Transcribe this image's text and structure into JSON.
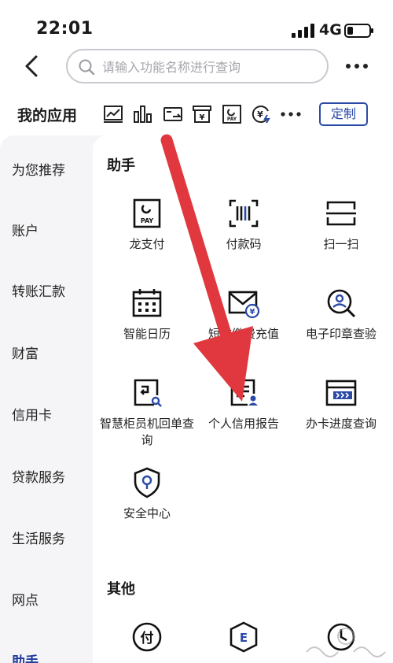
{
  "status_bar": {
    "time": "22:01",
    "network": "4G"
  },
  "search": {
    "placeholder": "请输入功能名称进行查询"
  },
  "my_apps": {
    "title": "我的应用",
    "custom_label": "定制"
  },
  "sidebar": {
    "items": [
      {
        "label": "为您推荐"
      },
      {
        "label": "账户"
      },
      {
        "label": "转账汇款"
      },
      {
        "label": "财富"
      },
      {
        "label": "信用卡"
      },
      {
        "label": "贷款服务"
      },
      {
        "label": "生活服务"
      },
      {
        "label": "网点"
      },
      {
        "label": "助手"
      }
    ],
    "active_index": 8
  },
  "sections": {
    "assistant": {
      "title": "助手",
      "apps": [
        {
          "label": "龙支付",
          "icon": "dragon-pay-icon"
        },
        {
          "label": "付款码",
          "icon": "payment-code-icon"
        },
        {
          "label": "扫一扫",
          "icon": "scan-icon"
        },
        {
          "label": "智能日历",
          "icon": "calendar-icon"
        },
        {
          "label": "短信缴费充值",
          "icon": "sms-recharge-icon"
        },
        {
          "label": "电子印章查验",
          "icon": "e-seal-verify-icon"
        },
        {
          "label": "智慧柜员机回单查询",
          "icon": "atm-receipt-icon"
        },
        {
          "label": "个人信用报告",
          "icon": "credit-report-icon"
        },
        {
          "label": "办卡进度查询",
          "icon": "card-progress-icon"
        },
        {
          "label": "安全中心",
          "icon": "security-center-icon"
        }
      ]
    },
    "other": {
      "title": "其他",
      "apps": [
        {
          "icon": "pay-circle-icon"
        },
        {
          "icon": "e-shield-icon"
        },
        {
          "icon": "clock-icon"
        }
      ]
    }
  },
  "colors": {
    "accent": "#1f3b9e",
    "arrow": "#e0383e"
  }
}
